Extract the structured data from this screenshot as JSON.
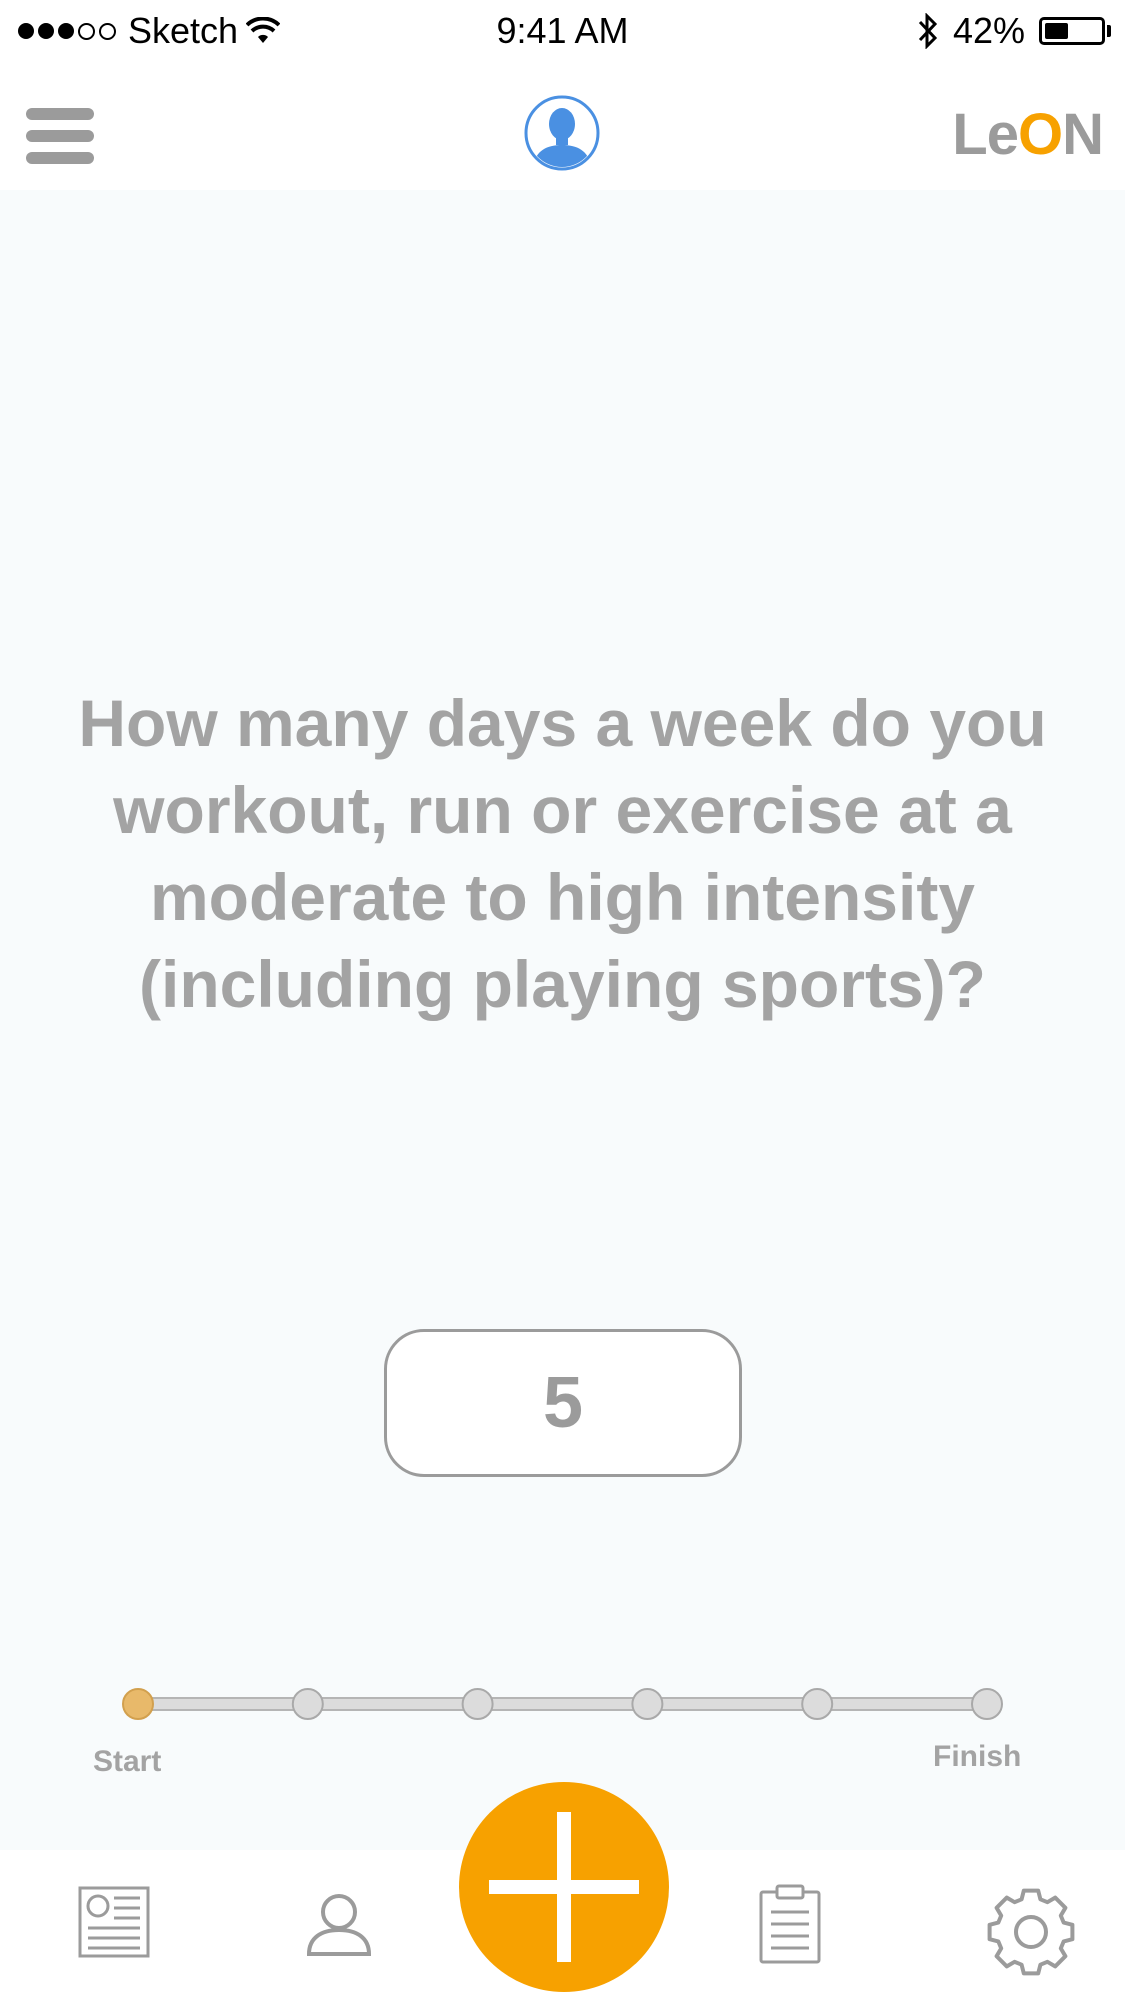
{
  "status_bar": {
    "carrier": "Sketch",
    "time": "9:41 AM",
    "battery_percent": "42%",
    "battery_level": 0.42,
    "signal_bars_filled": 3,
    "signal_bars_total": 5
  },
  "header": {
    "menu_icon": "hamburger-menu-icon",
    "avatar_icon": "user-avatar-icon",
    "logo_prefix": "Le",
    "logo_accent": "O",
    "logo_suffix": "N"
  },
  "question": {
    "text": "How many days a week do you workout, run or exercise at a moderate to high intensity (including playing sports)?"
  },
  "answer": {
    "value": "5"
  },
  "progress": {
    "steps_total": 6,
    "current_step": 1,
    "start_label": "Start",
    "finish_label": "Finish"
  },
  "tab_bar": {
    "items": [
      {
        "icon": "news-feed-icon"
      },
      {
        "icon": "profile-icon"
      },
      {
        "icon": "plus-icon"
      },
      {
        "icon": "clipboard-icon"
      },
      {
        "icon": "settings-gear-icon"
      }
    ]
  },
  "colors": {
    "accent": "#f7a100",
    "avatar_blue": "#4a90e2",
    "text_gray": "#a3a3a3",
    "icon_gray": "#9b9b9b",
    "progress_active": "#e8b96a",
    "background": "#f8fbfc"
  }
}
